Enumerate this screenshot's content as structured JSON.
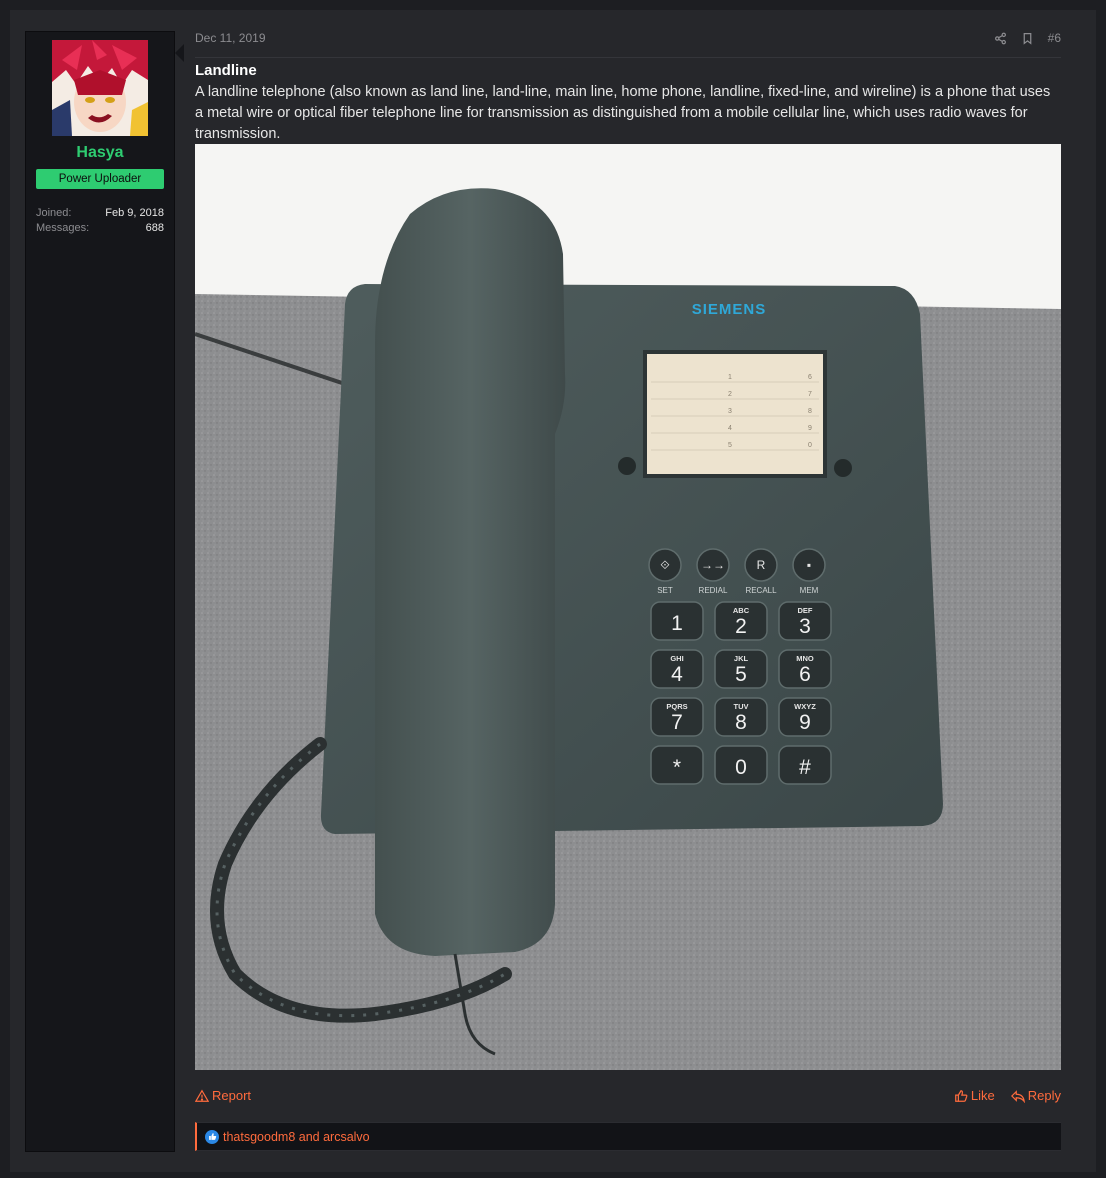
{
  "user": {
    "name": "Hasya",
    "rank": "Power Uploader",
    "joined_label": "Joined:",
    "joined_value": "Feb 9, 2018",
    "messages_label": "Messages:",
    "messages_value": "688"
  },
  "post": {
    "date": "Dec 11, 2019",
    "number": "#6",
    "title": "Landline",
    "body": "A landline telephone (also known as land line, land-line, main line, home phone, landline, fixed-line, and wireline) is a phone that uses a metal wire or optical fiber telephone line for transmission as distinguished from a mobile cellular line, which uses radio waves for transmission."
  },
  "photo": {
    "brand": "SIEMENS",
    "function_keys": [
      "SET",
      "REDIAL",
      "RECALL",
      "MEM"
    ],
    "function_symbols": [
      "⟐",
      "→→",
      "R",
      "▪"
    ],
    "keypad": [
      {
        "digit": "1",
        "letters": ""
      },
      {
        "digit": "2",
        "letters": "ABC"
      },
      {
        "digit": "3",
        "letters": "DEF"
      },
      {
        "digit": "4",
        "letters": "GHI"
      },
      {
        "digit": "5",
        "letters": "JKL"
      },
      {
        "digit": "6",
        "letters": "MNO"
      },
      {
        "digit": "7",
        "letters": "PQRS"
      },
      {
        "digit": "8",
        "letters": "TUV"
      },
      {
        "digit": "9",
        "letters": "WXYZ"
      },
      {
        "digit": "*",
        "letters": ""
      },
      {
        "digit": "0",
        "letters": ""
      },
      {
        "digit": "#",
        "letters": ""
      }
    ],
    "memory_left": [
      "1",
      "2",
      "3",
      "4",
      "5"
    ],
    "memory_right": [
      "6",
      "7",
      "8",
      "9",
      "0"
    ]
  },
  "actions": {
    "report": "Report",
    "like": "Like",
    "reply": "Reply"
  },
  "reactions": {
    "text": "thatsgoodm8 and arcsalvo"
  },
  "colors": {
    "accent": "#ff6b3d",
    "username": "#2ecc71",
    "badge": "#2ecc71",
    "reaction_like": "#2b88e6"
  }
}
